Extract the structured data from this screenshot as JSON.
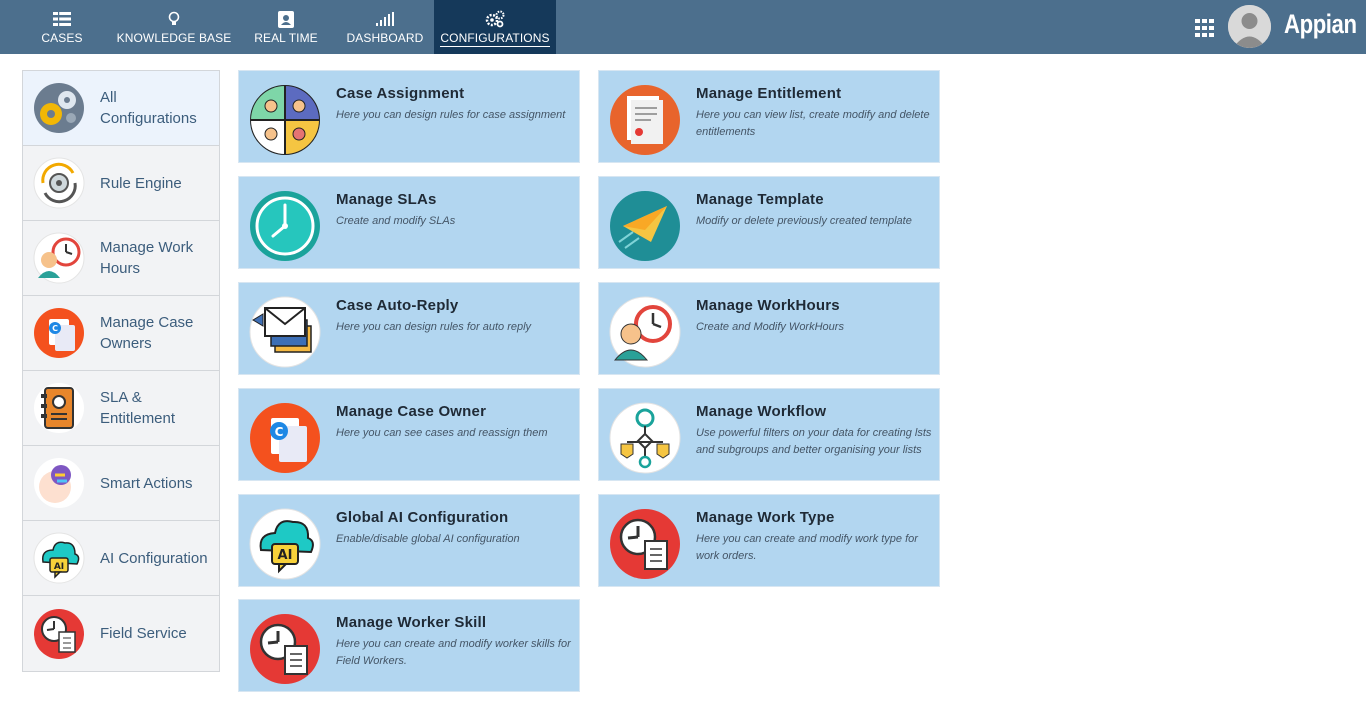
{
  "nav": {
    "tabs": [
      {
        "label": "CASES",
        "icon": "list-icon"
      },
      {
        "label": "KNOWLEDGE BASE",
        "icon": "lightbulb-icon"
      },
      {
        "label": "REAL TIME",
        "icon": "contact-card-icon"
      },
      {
        "label": "DASHBOARD",
        "icon": "signal-bars-icon"
      },
      {
        "label": "CONFIGURATIONS",
        "icon": "gears-icon",
        "active": true
      }
    ],
    "brand": "Appian"
  },
  "sidebar": {
    "items": [
      {
        "label": "All Configurations",
        "icon": "gears-icon",
        "active": true
      },
      {
        "label": "Rule Engine",
        "icon": "rule-engine-icon"
      },
      {
        "label": "Manage Work Hours",
        "icon": "work-hours-icon"
      },
      {
        "label": "Manage Case Owners",
        "icon": "case-owner-icon"
      },
      {
        "label": "SLA & Entitlement",
        "icon": "address-book-icon"
      },
      {
        "label": "Smart Actions",
        "icon": "smart-actions-icon"
      },
      {
        "label": "AI Configuration",
        "icon": "ai-cloud-icon"
      },
      {
        "label": "Field Service",
        "icon": "field-service-icon"
      }
    ]
  },
  "cards": {
    "left": [
      {
        "title": "Case Assignment",
        "desc": "Here you can design rules for case assignment",
        "icon": "people-group-icon"
      },
      {
        "title": "Manage SLAs",
        "desc": "Create and modify SLAs",
        "icon": "clock-icon"
      },
      {
        "title": "Case Auto-Reply",
        "desc": "Here you can design rules for auto reply",
        "icon": "envelope-icon"
      },
      {
        "title": "Manage Case Owner",
        "desc": "Here you can see cases and reassign them",
        "icon": "case-owner-icon"
      },
      {
        "title": "Global AI Configuration",
        "desc": "Enable/disable global AI configuration",
        "icon": "ai-cloud-icon"
      },
      {
        "title": "Manage Worker Skill",
        "desc": "Here you can create and modify worker skills for Field Workers.",
        "icon": "clock-checklist-icon"
      }
    ],
    "right": [
      {
        "title": "Manage Entitlement",
        "desc": "Here you can view list, create modify and delete entitlements",
        "icon": "certificate-icon"
      },
      {
        "title": "Manage Template",
        "desc": "Modify or delete previously created template",
        "icon": "paper-plane-icon"
      },
      {
        "title": "Manage WorkHours",
        "desc": "Create and Modify WorkHours",
        "icon": "work-hours-icon"
      },
      {
        "title": "Manage Workflow",
        "desc": "Use powerful filters on your data for creating lsts and subgroups and better organising your lists",
        "icon": "workflow-icon"
      },
      {
        "title": "Manage Work Type",
        "desc": "Here you can create and modify work type for work orders.",
        "icon": "clock-checklist-icon"
      }
    ]
  },
  "colors": {
    "topbar": "#4c6f8d",
    "active_tab": "#15395a",
    "card_bg": "#b2d6f0",
    "sidebar_bg": "#f2f3f5",
    "sidebar_active_bg": "#ecf3fc",
    "sidebar_text": "#3c5d7c"
  }
}
